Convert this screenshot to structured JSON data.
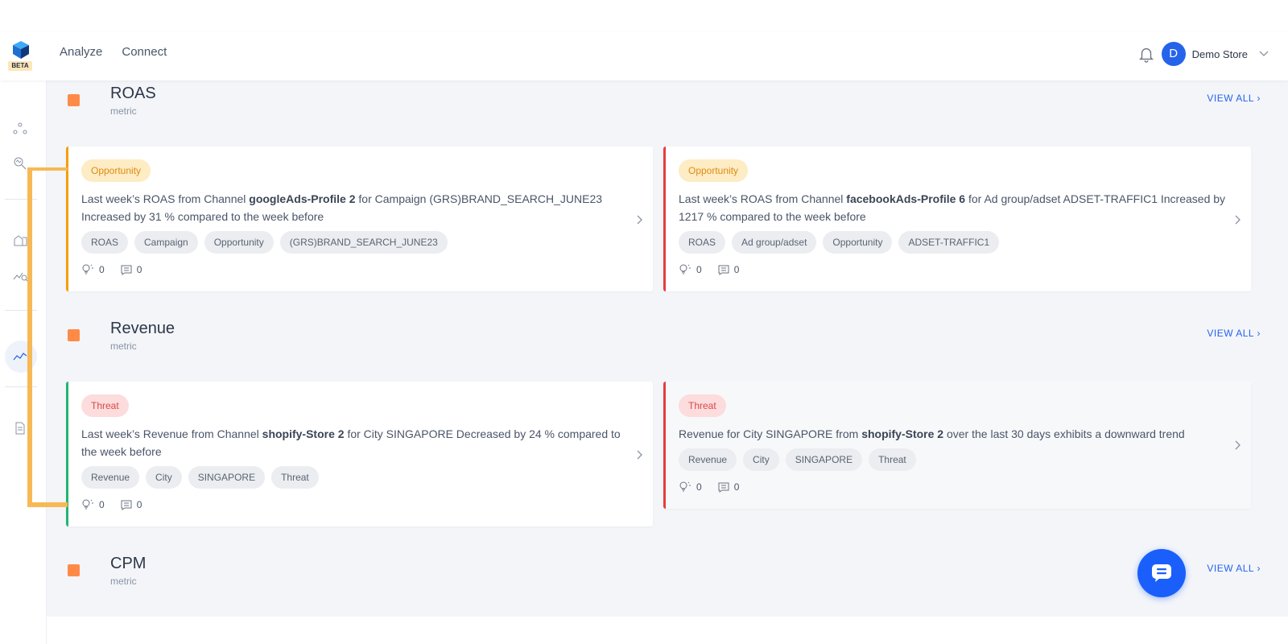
{
  "header": {
    "logo_badge": "BETA",
    "nav": [
      "Analyze",
      "Connect"
    ],
    "avatar_letter": "D",
    "store_name": "Demo Store"
  },
  "sections": [
    {
      "title": "ROAS",
      "subtitle": "metric",
      "view_all": "VIEW ALL",
      "cards": [
        {
          "type": "Opportunity",
          "text_parts": [
            "Last week’s ROAS from Channel ",
            "googleAds-Profile 2",
            " for Campaign (GRS)BRAND_SEARCH_JUNE23 Increased by 31 % compared to the week before"
          ],
          "tags": [
            "ROAS",
            "Campaign",
            "Opportunity",
            "(GRS)BRAND_SEARCH_JUNE23"
          ],
          "ideas": "0",
          "comments": "0"
        },
        {
          "type": "Opportunity",
          "text_parts": [
            "Last week’s ROAS from Channel ",
            "facebookAds-Profile 6",
            " for Ad group/adset ADSET-TRAFFIC1 Increased by 1217 % compared to the week before"
          ],
          "tags": [
            "ROAS",
            "Ad group/adset",
            "Opportunity",
            "ADSET-TRAFFIC1"
          ],
          "ideas": "0",
          "comments": "0"
        }
      ]
    },
    {
      "title": "Revenue",
      "subtitle": "metric",
      "view_all": "VIEW ALL",
      "cards": [
        {
          "type": "Threat",
          "text_parts": [
            "Last week’s Revenue from Channel ",
            "shopify-Store 2",
            " for City SINGAPORE Decreased by 24 % compared to the week before"
          ],
          "tags": [
            "Revenue",
            "City",
            "SINGAPORE",
            "Threat"
          ],
          "ideas": "0",
          "comments": "0"
        },
        {
          "type": "Threat",
          "text_parts": [
            "Revenue for City SINGAPORE from ",
            "shopify-Store 2",
            " over the last 30 days exhibits a downward trend"
          ],
          "tags": [
            "Revenue",
            "City",
            "SINGAPORE",
            "Threat"
          ],
          "ideas": "0",
          "comments": "0"
        }
      ]
    },
    {
      "title": "CPM",
      "subtitle": "metric",
      "view_all": "VIEW ALL",
      "cards": []
    }
  ],
  "colors": {
    "accent": "#2563eb",
    "opportunity": "#e08a10",
    "threat": "#d94848",
    "section_marker": "#ff8a47"
  }
}
